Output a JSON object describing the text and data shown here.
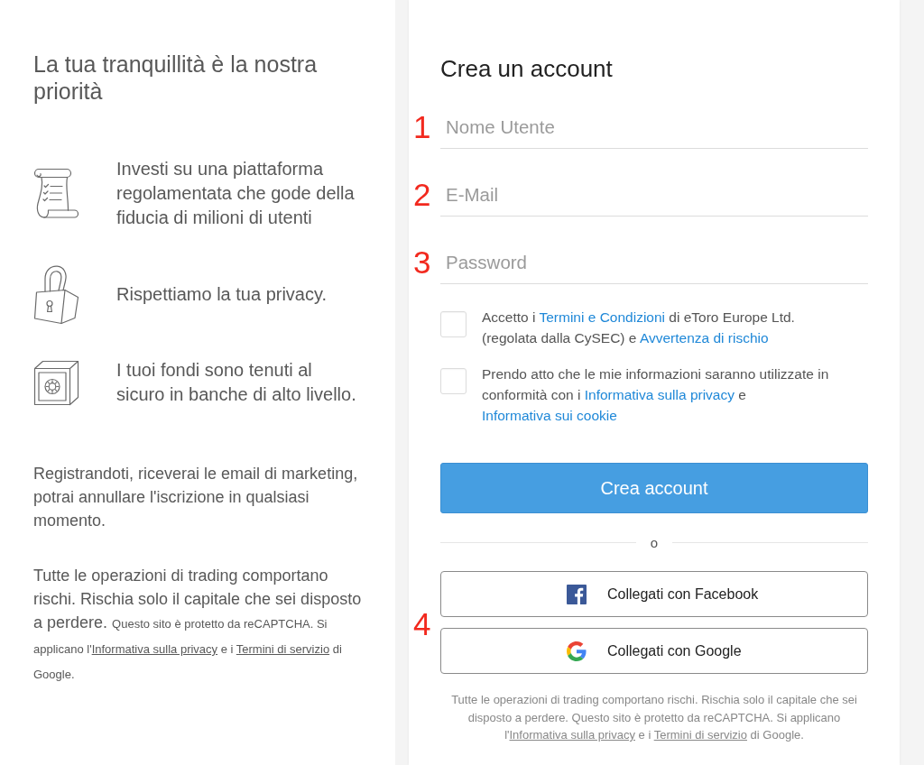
{
  "info_panel": {
    "heading": "La tua tranquillità è la nostra priorità",
    "features": [
      {
        "kind": "checklist",
        "text": "Investi su una piattaforma regolamentata che gode della fiducia di milioni di utenti"
      },
      {
        "kind": "lock",
        "text": "Rispettiamo la tua privacy."
      },
      {
        "kind": "safe",
        "text": "I tuoi fondi sono tenuti al sicuro in banche di alto livello."
      }
    ],
    "notes": [
      {
        "segments": [
          {
            "kind": "text",
            "text": "Registrandoti, riceverai le email di marketing, potrai annullare l'iscrizione in qualsiasi momento."
          }
        ]
      },
      {
        "segments": [
          {
            "kind": "text",
            "text": "Tutte le operazioni di trading comportano rischi. Rischia solo il capitale che sei disposto a perdere. "
          },
          {
            "kind": "small",
            "text": "Questo sito è protetto da reCAPTCHA. Si applicano l'"
          },
          {
            "kind": "link",
            "text": "Informativa sulla privacy"
          },
          {
            "kind": "small",
            "text": " e i "
          },
          {
            "kind": "link",
            "text": "Termini di servizio"
          },
          {
            "kind": "small",
            "text": " di Google."
          }
        ]
      }
    ]
  },
  "signup_form": {
    "title": "Crea un account",
    "fields": [
      {
        "step": "1",
        "placeholder": "Nome Utente"
      },
      {
        "step": "2",
        "placeholder": "E-Mail"
      },
      {
        "step": "3",
        "placeholder": "Password"
      }
    ],
    "consents": [
      {
        "checked": false,
        "segments": [
          {
            "kind": "text",
            "text": "Accetto i "
          },
          {
            "kind": "link",
            "text": "Termini e Condizioni"
          },
          {
            "kind": "text",
            "text": " di eToro Europe Ltd. (regolata dalla CySEC) e "
          },
          {
            "kind": "link",
            "text": "Avvertenza di rischio"
          }
        ]
      },
      {
        "checked": false,
        "segments": [
          {
            "kind": "text",
            "text": "Prendo atto che le mie informazioni saranno utilizzate in conformità con i "
          },
          {
            "kind": "link",
            "text": "Informativa sulla privacy"
          },
          {
            "kind": "text",
            "text": " e "
          },
          {
            "kind": "link",
            "text": "Informativa sui cookie"
          }
        ]
      }
    ],
    "submit": "Crea account",
    "separator": "o",
    "social": {
      "step": "4",
      "buttons": [
        {
          "kind": "facebook",
          "label": "Collegati con Facebook"
        },
        {
          "kind": "google",
          "label": "Collegati con Google"
        }
      ]
    },
    "disclaimer": {
      "segments": [
        {
          "kind": "text",
          "text": "Tutte le operazioni di trading comportano rischi. Rischia solo il capitale che sei disposto a perdere. Questo sito è protetto da reCAPTCHA. Si applicano l'"
        },
        {
          "kind": "link",
          "text": "Informativa sulla privacy"
        },
        {
          "kind": "text",
          "text": " e i "
        },
        {
          "kind": "link",
          "text": "Termini di servizio"
        },
        {
          "kind": "text",
          "text": " di Google."
        }
      ]
    }
  }
}
